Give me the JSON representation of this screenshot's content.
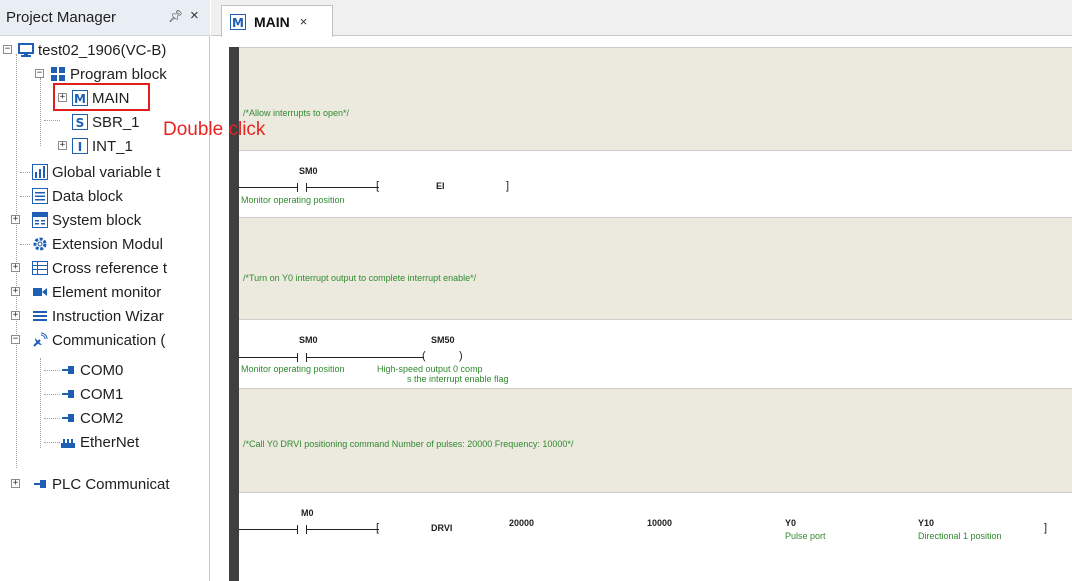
{
  "project_manager": {
    "title": "Project Manager",
    "pin_icon": "pin-icon",
    "close_label": "×",
    "tree": {
      "root": "test02_1906(VC-B)",
      "program_block": "Program block",
      "main": "MAIN",
      "sbr": "SBR_1",
      "int": "INT_1",
      "global_vars": "Global variable t",
      "data_block": "Data block",
      "system_block": "System block",
      "extension": "Extension Modul",
      "cross_ref": "Cross reference t",
      "element_monitor": "Element monitor",
      "instruction_wizard": "Instruction Wizar",
      "communication": "Communication (",
      "com0": "COM0",
      "com1": "COM1",
      "com2": "COM2",
      "ethernet": "EtherNet",
      "plc_comm": "PLC Communicat"
    }
  },
  "annotation": {
    "text": "Double click",
    "color": "#e82424"
  },
  "tab": {
    "label": "MAIN",
    "close": "×"
  },
  "ladder": {
    "comment1": "/*Allow interrupts to open*/",
    "rung1": {
      "contact": "SM0",
      "instr": "EI",
      "bracket": "]",
      "contact_comment": "Monitor operating position"
    },
    "comment2": "/*Turn on Y0 interrupt output to complete interrupt enable*/",
    "rung2": {
      "contact": "SM0",
      "coil": "SM50",
      "contact_comment": "Monitor operating position",
      "coil_comment_1": "High-speed output 0 comp",
      "coil_comment_2": "s the interrupt enable flag"
    },
    "comment3": "/*Call Y0 DRVI positioning command    Number of pulses: 20000    Frequency: 10000*/",
    "rung3": {
      "contact": "M0",
      "instr": "DRVI",
      "arg1": "20000",
      "arg2": "10000",
      "arg3": "Y0",
      "arg3_comment": "Pulse port",
      "arg4": "Y10",
      "arg4_comment": "Directional 1 position",
      "bracket": "]"
    }
  },
  "colors": {
    "comment_green": "#2f8a2f",
    "comment_band": "#ece9df",
    "highlight_red": "#e01e1e"
  }
}
